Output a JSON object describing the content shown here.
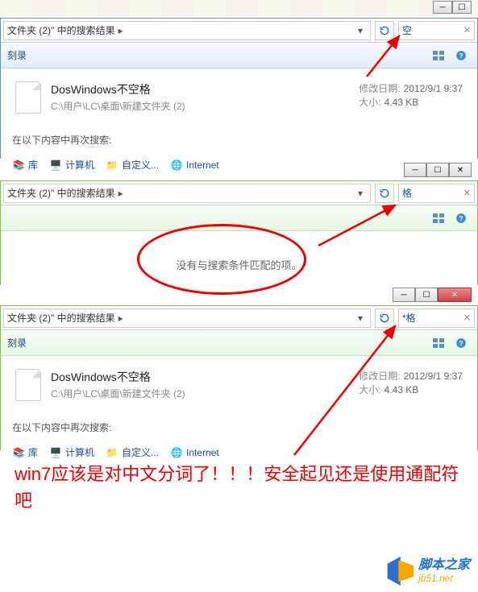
{
  "topstrip": {
    "visible": true
  },
  "panel1": {
    "breadcrumb": "文件夹 (2)\" 中的搜索结果",
    "search_value": "空",
    "toolbar_label": "刻录",
    "result": {
      "filename": "DosWindows不空格",
      "path": "C:\\用户\\LC\\桌面\\新建文件夹 (2)",
      "mod_label": "修改日期:",
      "mod_value": "2012/9/1 9:37",
      "size_label": "大小:",
      "size_value": "4.43 KB"
    },
    "search_again_label": "在以下内容中再次搜索:",
    "links": {
      "libraries": "库",
      "computer": "计算机",
      "custom": "自定义...",
      "internet": "Internet"
    }
  },
  "panel2": {
    "breadcrumb": "文件夹 (2)\" 中的搜索结果",
    "search_value": "格",
    "no_results_text": "没有与搜索条件匹配的项。"
  },
  "panel3": {
    "breadcrumb": "文件夹 (2)\" 中的搜索结果",
    "search_value": "*格",
    "toolbar_label": "刻录",
    "result": {
      "filename": "DosWindows不空格",
      "path": "C:\\用户\\LC\\桌面\\新建文件夹 (2)",
      "mod_label": "修改日期:",
      "mod_value": "2012/9/1 9:37",
      "size_label": "大小:",
      "size_value": "4.43 KB"
    },
    "search_again_label": "在以下内容中再次搜索:",
    "links": {
      "libraries": "库",
      "computer": "计算机",
      "custom": "自定义...",
      "internet": "Internet"
    }
  },
  "annotation": "win7应该是对中文分词了！！！安全起见还是使用通配符吧",
  "footer": {
    "brand": "脚本之家",
    "domain": "jb51.net"
  }
}
